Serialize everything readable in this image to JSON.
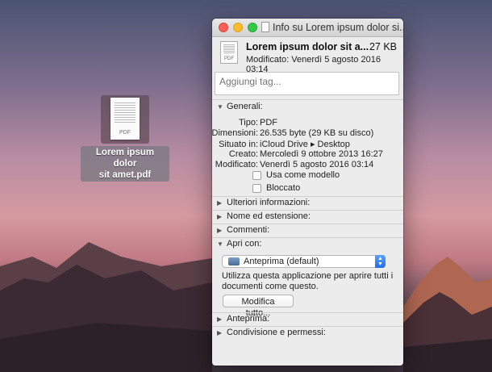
{
  "desktop": {
    "file_label_line1": "Lorem ipsum dolor",
    "file_label_line2": "sit amet.pdf",
    "thumb_ext": "PDF"
  },
  "window": {
    "title": "Info su Lorem ipsum dolor si...",
    "header": {
      "name": "Lorem ipsum dolor sit a...",
      "size": "27 KB",
      "modified": "Modificato:  Venerdì 5 agosto 2016 03:14",
      "icon_ext": "PDF"
    },
    "tags_placeholder": "Aggiungi tag...",
    "general": {
      "heading": "Generali:",
      "rows": [
        {
          "k": "Tipo:",
          "v": "PDF"
        },
        {
          "k": "Dimensioni:",
          "v": "26.535 byte (29 KB su disco)"
        },
        {
          "k": "Situato in:",
          "v": "iCloud Drive ▸ Desktop"
        },
        {
          "k": "Creato:",
          "v": "Mercoledì 9 ottobre 2013 16:27"
        },
        {
          "k": "Modificato:",
          "v": "Venerdì 5 agosto 2016 03:14"
        }
      ],
      "checkbox_template": "Usa come modello",
      "checkbox_locked": "Bloccato"
    },
    "sections": {
      "more_info": "Ulteriori informazioni:",
      "name_ext": "Nome ed estensione:",
      "comments": "Commenti:",
      "open_with": "Apri con:",
      "preview": "Anteprima:",
      "sharing": "Condivisione e permessi:"
    },
    "open_with": {
      "selected_app": "Anteprima (default)",
      "description": "Utilizza questa applicazione per aprire tutti i documenti come questo.",
      "change_all_button": "Modifica tutto..."
    }
  }
}
